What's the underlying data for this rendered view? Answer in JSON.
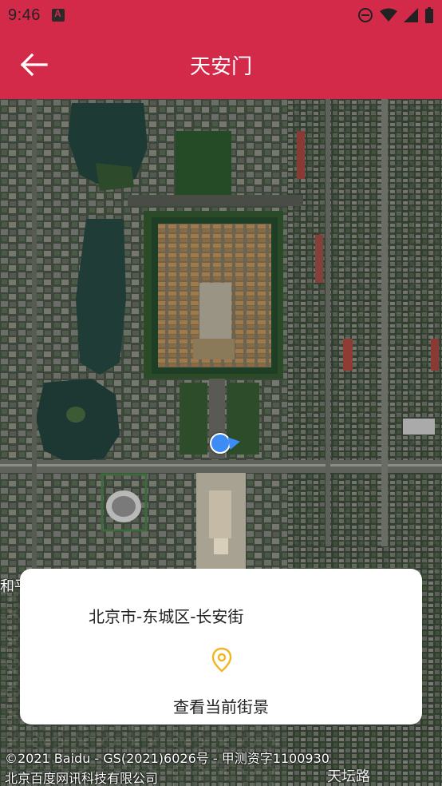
{
  "status_bar": {
    "time": "9:46",
    "icons": [
      "app-notification-icon",
      "do-not-disturb-icon",
      "wifi-icon",
      "signal-icon",
      "battery-icon"
    ]
  },
  "app_bar": {
    "title": "天安门",
    "back_icon": "arrow-left-icon"
  },
  "map": {
    "edge_label": "和平",
    "road_label": "天坛路",
    "attribution_line1": "©2021 Baidu - GS(2021)6026号 - 甲测资字1100930",
    "attribution_line2": "北京百度网讯科技有限公司",
    "current_location_marker": "location-dot"
  },
  "card": {
    "address": "北京市-东城区-长安街",
    "pin_icon": "location-pin-icon",
    "pin_color": "#f2b51f",
    "action_label": "查看当前街景"
  },
  "colors": {
    "accent": "#d42a4a",
    "location_dot": "#3d8cf6"
  }
}
